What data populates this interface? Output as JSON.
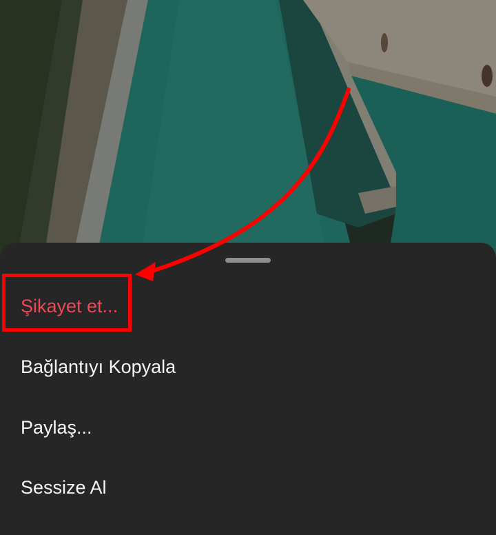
{
  "background": {
    "description_icon": "pool-photo-image"
  },
  "sheet": {
    "items": [
      {
        "label": "Şikayet et...",
        "color": "#ed4956"
      },
      {
        "label": "Bağlantıyı Kopyala",
        "color": "#f5f5f5"
      },
      {
        "label": "Paylaş...",
        "color": "#f5f5f5"
      },
      {
        "label": "Sessize Al",
        "color": "#f5f5f5"
      }
    ]
  },
  "annotation": {
    "color": "#ff0000",
    "icon": "arrow-icon"
  }
}
